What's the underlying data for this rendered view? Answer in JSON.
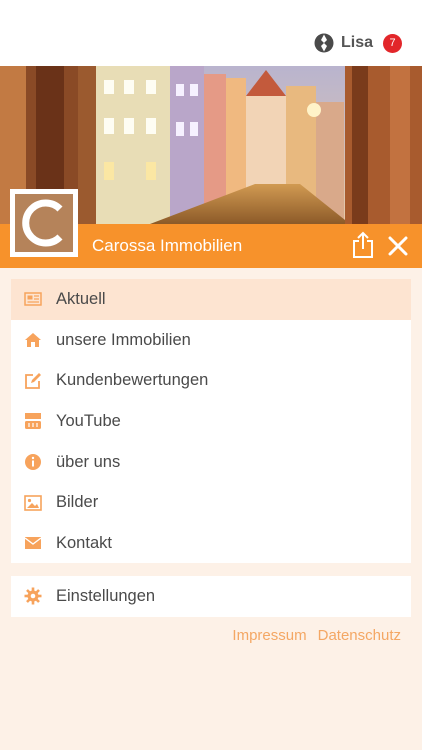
{
  "header": {
    "user_name": "Lisa",
    "notification_count": "7"
  },
  "brand": {
    "name": "Carossa Immobilien",
    "logo_letter": "C"
  },
  "menu": {
    "items": [
      {
        "label": "Aktuell",
        "icon": "newspaper-icon",
        "active": true
      },
      {
        "label": "unsere Immobilien",
        "icon": "home-icon",
        "active": false
      },
      {
        "label": "Kundenbewertungen",
        "icon": "edit-icon",
        "active": false
      },
      {
        "label": "YouTube",
        "icon": "youtube-icon",
        "active": false
      },
      {
        "label": "über uns",
        "icon": "info-icon",
        "active": false
      },
      {
        "label": "Bilder",
        "icon": "image-icon",
        "active": false
      },
      {
        "label": "Kontakt",
        "icon": "envelope-icon",
        "active": false
      }
    ]
  },
  "settings": {
    "label": "Einstellungen",
    "icon": "gear-icon"
  },
  "footer": {
    "impressum": "Impressum",
    "datenschutz": "Datenschutz"
  },
  "colors": {
    "accent": "#f7922b",
    "icon": "#f7a35c",
    "active_bg": "#fde4d1",
    "badge": "#e2262a",
    "page_bg": "#fdf1e7"
  }
}
